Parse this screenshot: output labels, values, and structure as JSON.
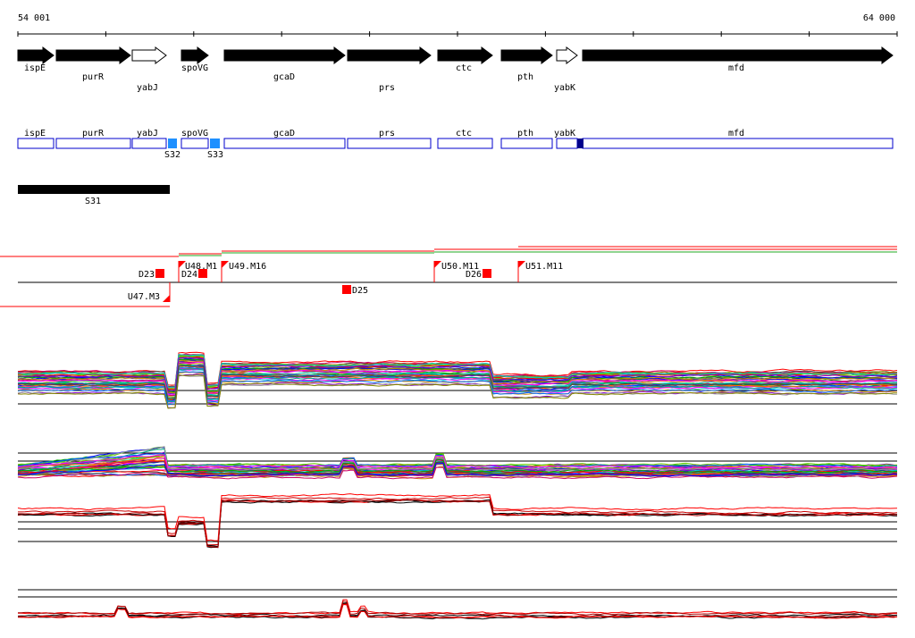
{
  "coords": {
    "start": "54 001",
    "end": "64 000"
  },
  "genes": [
    {
      "label": "ispE",
      "style": "filled"
    },
    {
      "label": "purR",
      "style": "filled"
    },
    {
      "label": "yabJ",
      "style": "outline"
    },
    {
      "label": "spoVG",
      "style": "filled"
    },
    {
      "label": "gcaD",
      "style": "filled"
    },
    {
      "label": "prs",
      "style": "filled"
    },
    {
      "label": "ctc",
      "style": "filled"
    },
    {
      "label": "pth",
      "style": "filled"
    },
    {
      "label": "yabK",
      "style": "outline"
    },
    {
      "label": "mfd",
      "style": "filled"
    }
  ],
  "boxes": [
    "ispE",
    "purR",
    "yabJ",
    "spoVG",
    "gcaD",
    "prs",
    "ctc",
    "pth",
    "yabK",
    "mfd"
  ],
  "sites": [
    {
      "label": "S32"
    },
    {
      "label": "S33"
    }
  ],
  "region": {
    "label": "S31"
  },
  "upstream_markers": [
    "U48.M1",
    "U49.M16",
    "U50.M11",
    "U51.M11"
  ],
  "lower_markers": [
    "U47.M3"
  ],
  "down_markers": [
    "D23",
    "D24",
    "D26",
    "D25"
  ],
  "colors": {
    "gene": "#000000",
    "box": "#0000cc",
    "site": "#1e90ff",
    "marker": "#ff0000",
    "green_line": "#22aa22"
  }
}
